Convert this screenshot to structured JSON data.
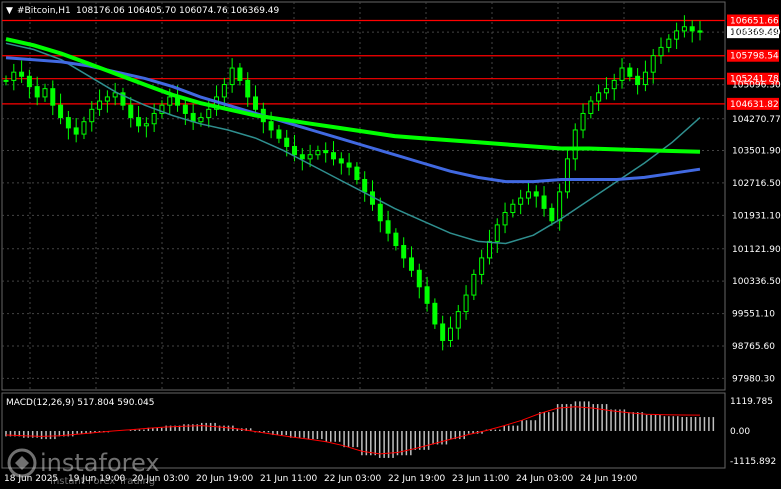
{
  "header": {
    "symbol": "#Bitcoin,H1",
    "ohlc": "108176.06 106405.70 106074.76 106369.49"
  },
  "price_axis": {
    "ticks": [
      "106369.49",
      "105096.30",
      "104270.77",
      "103501.90",
      "102716.50",
      "101931.10",
      "101121.90",
      "100336.50",
      "99551.10",
      "98765.60",
      "97980.30"
    ]
  },
  "levels": [
    {
      "label": "106651.66",
      "value": 106651.66
    },
    {
      "label": "105798.54",
      "value": 105798.54
    },
    {
      "label": "105241.78",
      "value": 105241.78
    },
    {
      "label": "104631.82",
      "value": 104631.82
    }
  ],
  "current_price": {
    "label": "106369.49",
    "value": 106369.49
  },
  "time_axis": [
    "18 Jun 2025",
    "19 Jun 19:00",
    "20 Jun 03:00",
    "20 Jun 19:00",
    "21 Jun 11:00",
    "22 Jun 03:00",
    "22 Jun 19:00",
    "23 Jun 11:00",
    "24 Jun 03:00",
    "24 Jun 19:00"
  ],
  "macd": {
    "label": "MACD(12,26,9) 517.804 590.045",
    "ticks": [
      "1119.785",
      "0.00",
      "-1115.892"
    ]
  },
  "watermark": {
    "brand": "instaforex",
    "tagline": "Instant Forex Trading"
  },
  "colors": {
    "background": "#000000",
    "candle": "#00ff00",
    "ma_fast": "#2f8f8f",
    "ma_mid": "#4169e1",
    "ma_slow": "#00ff00",
    "level": "#ff0000",
    "macd_hist": "#c0c0c0",
    "macd_signal": "#ff0000"
  },
  "chart_data": {
    "type": "candlestick",
    "ylim": [
      97700,
      107100
    ],
    "close_series": [
      105200,
      105400,
      105300,
      105050,
      104800,
      105000,
      104600,
      104300,
      104050,
      103900,
      104200,
      104500,
      104700,
      104800,
      104900,
      104600,
      104300,
      104100,
      104150,
      104400,
      104600,
      104800,
      104600,
      104400,
      104200,
      104300,
      104500,
      104800,
      105100,
      105500,
      105200,
      104800,
      104500,
      104200,
      104000,
      103800,
      103600,
      103400,
      103300,
      103400,
      103500,
      103450,
      103300,
      103200,
      103100,
      102800,
      102500,
      102200,
      101800,
      101500,
      101200,
      100900,
      100600,
      100200,
      99800,
      99300,
      98900,
      99200,
      99600,
      100000,
      100500,
      100900,
      101300,
      101700,
      102000,
      102200,
      102350,
      102500,
      102400,
      102100,
      101800,
      102500,
      103300,
      104000,
      104400,
      104700,
      104900,
      105000,
      105200,
      105500,
      105300,
      105100,
      105400,
      105800,
      106000,
      106200,
      106400,
      106500,
      106400,
      106369.49
    ],
    "ma_fast": [
      106100,
      105950,
      105700,
      105300,
      104900,
      104600,
      104350,
      104150,
      104000,
      103800,
      103500,
      103150,
      102800,
      102450,
      102100,
      101800,
      101500,
      101300,
      101250,
      101450,
      101850,
      102300,
      102750,
      103200,
      103700,
      104300
    ],
    "ma_mid": [
      105750,
      105700,
      105650,
      105550,
      105400,
      105250,
      105050,
      104800,
      104600,
      104400,
      104200,
      104000,
      103800,
      103600,
      103400,
      103200,
      103000,
      102850,
      102750,
      102750,
      102800,
      102800,
      102800,
      102850,
      102950,
      103050
    ],
    "ma_slow": [
      106200,
      106050,
      105850,
      105600,
      105350,
      105100,
      104850,
      104650,
      104500,
      104350,
      104250,
      104150,
      104050,
      103950,
      103850,
      103800,
      103750,
      103700,
      103650,
      103600,
      103550,
      103550,
      103530,
      103510,
      103490,
      103470
    ],
    "macd_hist": [
      -200,
      -250,
      -300,
      -200,
      -100,
      -50,
      0,
      50,
      120,
      200,
      250,
      300,
      200,
      100,
      -50,
      -150,
      -250,
      -300,
      -400,
      -600,
      -900,
      -1000,
      -900,
      -700,
      -500,
      -300,
      -100,
      50,
      200,
      400,
      700,
      1000,
      1100,
      1000,
      800,
      700,
      600,
      550,
      520,
      518
    ],
    "macd_signal": [
      -150,
      -180,
      -200,
      -180,
      -120,
      -60,
      0,
      50,
      100,
      150,
      180,
      200,
      150,
      80,
      -20,
      -120,
      -220,
      -300,
      -400,
      -550,
      -750,
      -850,
      -800,
      -650,
      -480,
      -300,
      -130,
      20,
      200,
      400,
      650,
      850,
      900,
      850,
      750,
      680,
      620,
      600,
      595,
      590
    ]
  }
}
